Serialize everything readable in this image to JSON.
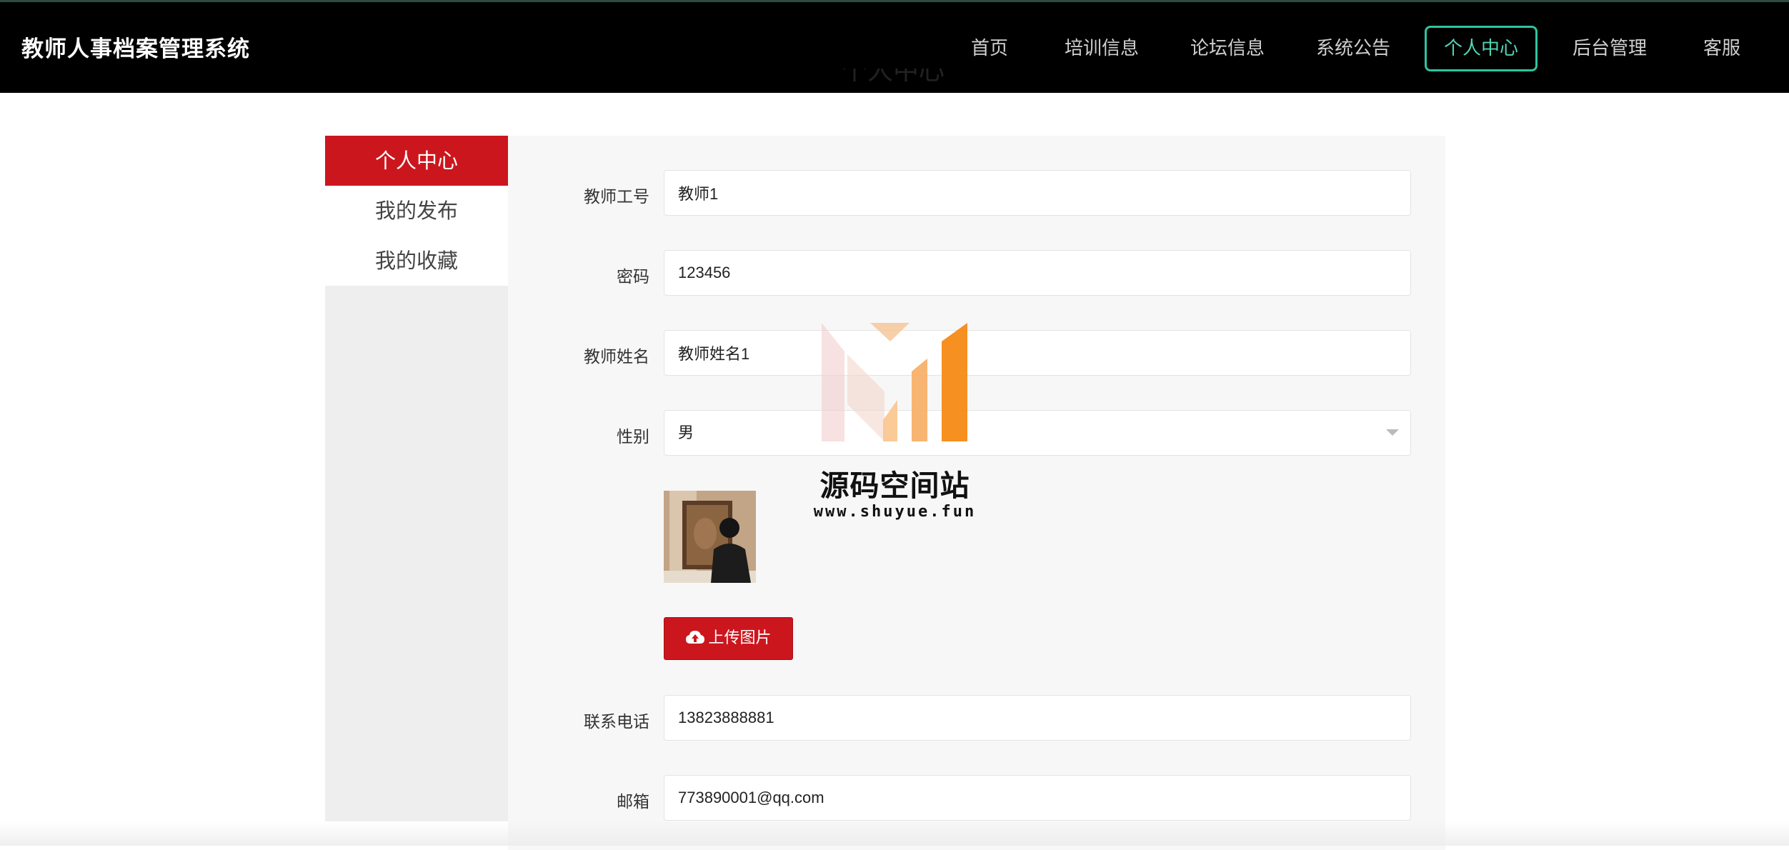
{
  "header": {
    "site_title": "教师人事档案管理系统",
    "nav": [
      "首页",
      "培训信息",
      "论坛信息",
      "系统公告",
      "个人中心",
      "后台管理",
      "客服"
    ],
    "active_nav": "个人中心",
    "accent_color": "#2ec4a0"
  },
  "page": {
    "heading": "个人中心"
  },
  "sidebar": {
    "items": [
      "个人中心",
      "我的发布",
      "我的收藏"
    ],
    "active_item": "个人中心",
    "active_color": "#cc161e"
  },
  "form": {
    "teacher_id": {
      "label": "教师工号",
      "value": "教师1"
    },
    "password": {
      "label": "密码",
      "value": "123456"
    },
    "teacher_name": {
      "label": "教师姓名",
      "value": "教师姓名1"
    },
    "gender": {
      "label": "性别",
      "value": "男"
    },
    "upload_button": "上传图片",
    "phone": {
      "label": "联系电话",
      "value": "13823888881"
    },
    "email": {
      "label": "邮箱",
      "value": "773890001@qq.com"
    }
  },
  "watermark": {
    "title": "源码空间站",
    "url": "www.shuyue.fun"
  },
  "icons": {
    "upload": "cloud-upload-icon",
    "select": "chevron-down-icon"
  }
}
